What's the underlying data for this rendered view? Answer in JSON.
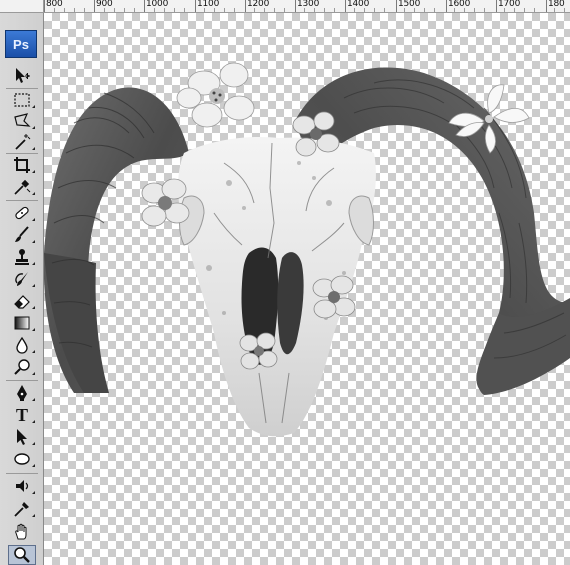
{
  "ruler": {
    "labels": [
      "800",
      "900",
      "1000",
      "1100",
      "1200",
      "1300",
      "1400",
      "1500",
      "1600",
      "1700",
      "180"
    ]
  },
  "toolbar": {
    "logo": "Ps",
    "tools": [
      {
        "name": "move-tool",
        "icon": "move-icon"
      },
      {
        "name": "marquee-tool",
        "icon": "marquee-icon"
      },
      {
        "name": "lasso-tool",
        "icon": "lasso-icon"
      },
      {
        "name": "magic-wand-tool",
        "icon": "magic-wand-icon"
      },
      {
        "name": "crop-tool",
        "icon": "crop-icon"
      },
      {
        "name": "eyedropper-tool",
        "icon": "eyedropper-icon"
      },
      {
        "name": "healing-brush-tool",
        "icon": "bandage-icon"
      },
      {
        "name": "brush-tool",
        "icon": "brush-icon"
      },
      {
        "name": "clone-stamp-tool",
        "icon": "stamp-icon"
      },
      {
        "name": "history-brush-tool",
        "icon": "history-brush-icon"
      },
      {
        "name": "eraser-tool",
        "icon": "eraser-icon"
      },
      {
        "name": "gradient-tool",
        "icon": "gradient-icon"
      },
      {
        "name": "blur-tool",
        "icon": "drop-icon"
      },
      {
        "name": "dodge-tool",
        "icon": "dodge-icon"
      },
      {
        "name": "pen-tool",
        "icon": "pen-icon"
      },
      {
        "name": "type-tool",
        "icon": "type-icon"
      },
      {
        "name": "path-selection-tool",
        "icon": "arrow-icon"
      },
      {
        "name": "shape-tool",
        "icon": "ellipse-icon"
      },
      {
        "name": "3d-rotate-tool",
        "icon": "3d-rotate-icon"
      },
      {
        "name": "3d-camera-tool",
        "icon": "eyedropper-icon"
      },
      {
        "name": "hand-tool",
        "icon": "hand-icon"
      },
      {
        "name": "zoom-tool",
        "icon": "zoom-icon"
      }
    ],
    "type_glyph": "T",
    "active_tool": "zoom-tool"
  },
  "canvas": {
    "background": "transparent-checkerboard",
    "image": "ram-skull-with-flowers"
  }
}
